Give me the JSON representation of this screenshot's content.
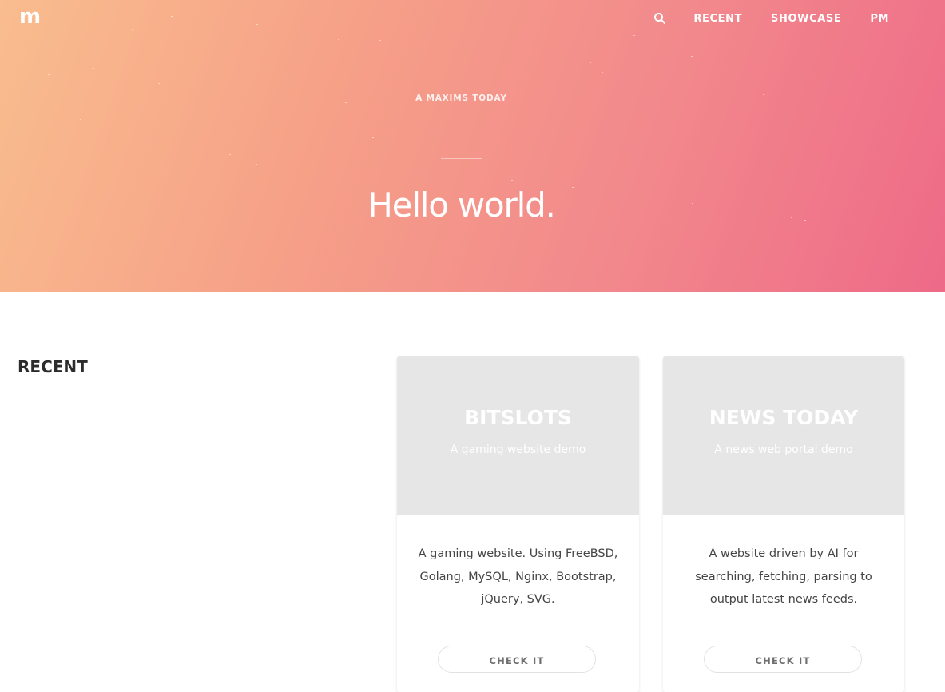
{
  "header": {
    "logo_text": "m",
    "search_icon": "search-icon",
    "nav": [
      "RECENT",
      "SHOWCASE",
      "PM"
    ]
  },
  "hero": {
    "kicker": "A MAXIMS TODAY",
    "headline": "Hello world."
  },
  "recent": {
    "title": "RECENT",
    "cards": [
      {
        "thumb_title": "BITSLOTS",
        "thumb_subtitle": "A gaming website demo",
        "description": "A gaming website. Using FreeBSD, Golang, MySQL, Nginx, Bootstrap, jQuery, SVG.",
        "button_label": "CHECK IT"
      },
      {
        "thumb_title": "NEWS TODAY",
        "thumb_subtitle": "A news web portal demo",
        "description": "A website driven by AI for searching, fetching, parsing to output latest news feeds.",
        "button_label": "CHECK IT"
      }
    ]
  },
  "colors": {
    "hero_gradient_start": "#f9bd8e",
    "hero_gradient_end": "#ee6a88",
    "thumb_bg": "#e6e6e6",
    "heading_text": "#2c2c2c"
  }
}
